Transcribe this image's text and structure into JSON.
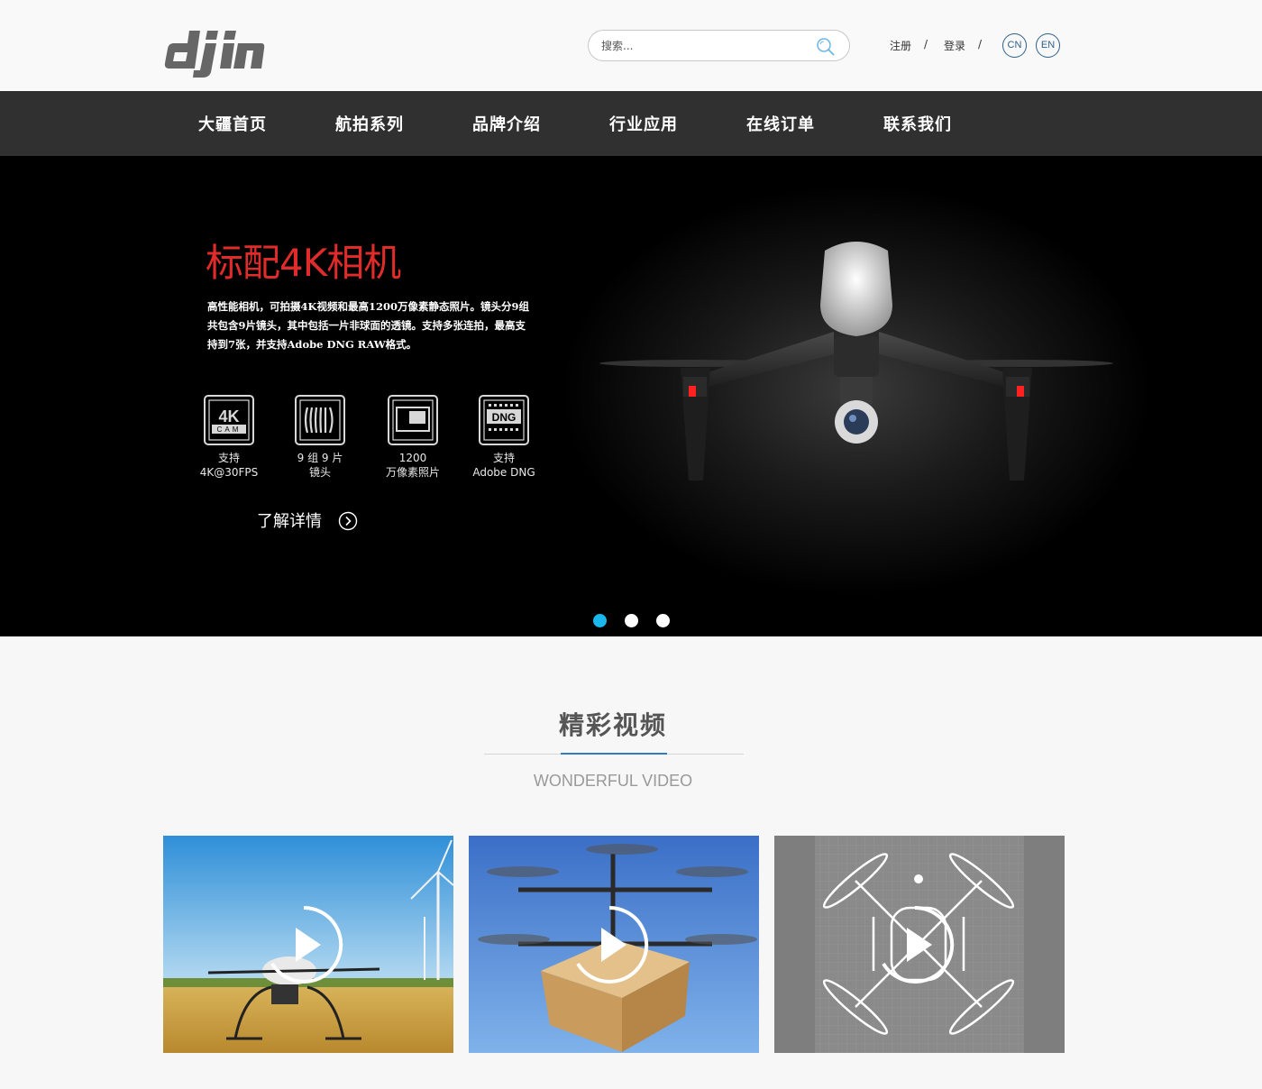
{
  "header": {
    "logo_text": "dji",
    "search_placeholder": "搜索...",
    "register": "注册",
    "login": "登录",
    "separator": "/",
    "lang_cn": "CN",
    "lang_en": "EN"
  },
  "nav": {
    "items": [
      "大疆首页",
      "航拍系列",
      "品牌介绍",
      "行业应用",
      "在线订单",
      "联系我们"
    ]
  },
  "hero": {
    "title": "标配4K相机",
    "description": "高性能相机，可拍摄4K视频和最高1200万像素静态照片。镜头分9组共包含9片镜头，其中包括一片非球面的透镜。支持多张连拍，最高支持到7张，并支持Adobe DNG RAW格式。",
    "features": [
      {
        "icon": "4k-cam-icon",
        "line1": "支持",
        "line2": "4K@30FPS",
        "badge_top": "4K",
        "badge_bottom": "CAM"
      },
      {
        "icon": "lens-icon",
        "line1": "9 组 9 片",
        "line2": "镜头"
      },
      {
        "icon": "photo-icon",
        "line1": "1200",
        "line2": "万像素照片"
      },
      {
        "icon": "dng-icon",
        "line1": "支持",
        "line2": "Adobe DNG",
        "badge": "DNG"
      }
    ],
    "more_label": "了解详情",
    "slides_count": 3,
    "active_slide": 1,
    "accent_color": "#e02b2b",
    "active_dot_color": "#19b7ec"
  },
  "videos": {
    "title": "精彩视频",
    "subtitle": "WONDERFUL VIDEO",
    "items": [
      {
        "name": "video-wheatfield-drone"
      },
      {
        "name": "video-delivery-drone"
      },
      {
        "name": "video-blueprint-drone"
      }
    ]
  }
}
